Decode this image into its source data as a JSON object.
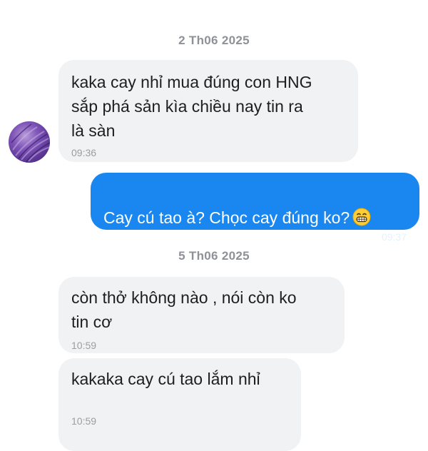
{
  "conversation": {
    "date_1": "2 Th06 2025",
    "date_2": "5 Th06 2025",
    "messages": [
      {
        "text": "kaka cay nhỉ mua đúng con HNG\nsắp phá sản kìa chiều nay tin ra\nlà sàn",
        "time": "09:36",
        "direction": "incoming"
      },
      {
        "text": "Cay cú tao à? Chọc cay đúng ko?",
        "emoji": "grinning-face-emoji",
        "time": "09:37",
        "direction": "outgoing"
      },
      {
        "text": "còn thở không nào , nói còn ko\ntin cơ",
        "time": "10:59",
        "direction": "incoming"
      },
      {
        "text": "kakaka cay cú tao lắm nhỉ",
        "time": "10:59",
        "direction": "incoming"
      }
    ]
  },
  "colors": {
    "incoming_bubble": "#f1f2f4",
    "outgoing_bubble": "#1a86f0",
    "date_text": "#8e9196"
  }
}
